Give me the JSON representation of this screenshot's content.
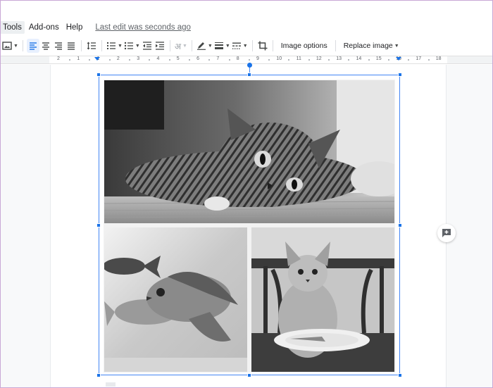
{
  "menu": {
    "items": [
      {
        "label": "Tools"
      },
      {
        "label": "Add-ons"
      },
      {
        "label": "Help"
      }
    ],
    "last_edit": "Last edit was seconds ago"
  },
  "toolbar": {
    "image_options_label": "Image options",
    "replace_image_label": "Replace image",
    "icons": [
      "image-icon",
      "align-left-icon",
      "align-center-icon",
      "align-right-icon",
      "justify-icon",
      "line-spacing-icon",
      "numbered-list-icon",
      "bulleted-list-icon",
      "decrease-indent-icon",
      "increase-indent-icon",
      "input-tools-icon",
      "border-color-icon",
      "border-weight-icon",
      "border-dash-icon",
      "crop-icon"
    ],
    "input_tools_glyph": "अ",
    "accent_color": "#1a73e8"
  },
  "ruler": {
    "numbers": [
      "2",
      "1",
      "1",
      "2",
      "3",
      "4",
      "5",
      "6",
      "7",
      "8",
      "9",
      "10",
      "11",
      "12",
      "13",
      "14",
      "15",
      "16",
      "17",
      "18"
    ]
  },
  "document": {
    "selection_color": "#4285f4",
    "photos": [
      {
        "subject": "cat-lying-photo"
      },
      {
        "subject": "fish-photo"
      },
      {
        "subject": "cat-with-plate-photo"
      }
    ]
  },
  "side": {
    "add_comment_icon": "add-comment-icon"
  }
}
